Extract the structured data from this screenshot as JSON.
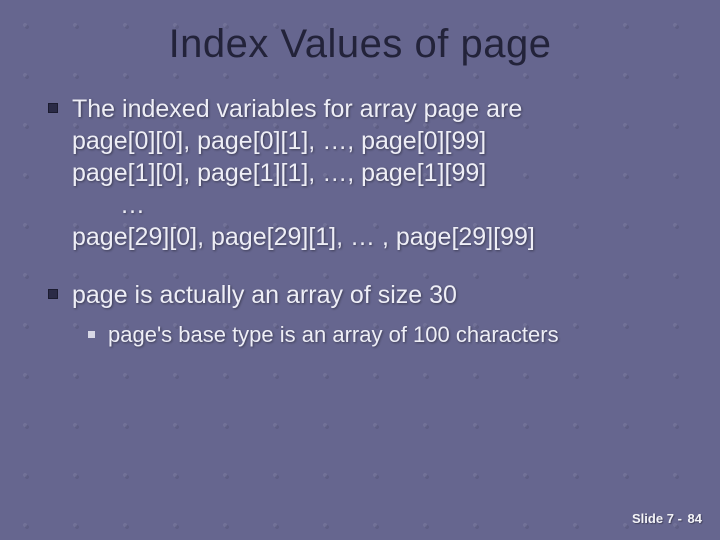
{
  "title": "Index Values of page",
  "bullets": {
    "b1": {
      "l1": "The indexed variables for array page are",
      "l2": "page[0][0], page[0][1], …, page[0][99]",
      "l3": "page[1][0], page[1][1], …, page[1][99]",
      "l4": "…",
      "l5": "page[29][0], page[29][1], … , page[29][99]"
    },
    "b2": {
      "l1": "page is actually an array of size 30",
      "sub1": "page's base type is an array of 100 characters"
    }
  },
  "footer": {
    "label": "Slide 7",
    "sep": "-",
    "num": "84"
  }
}
